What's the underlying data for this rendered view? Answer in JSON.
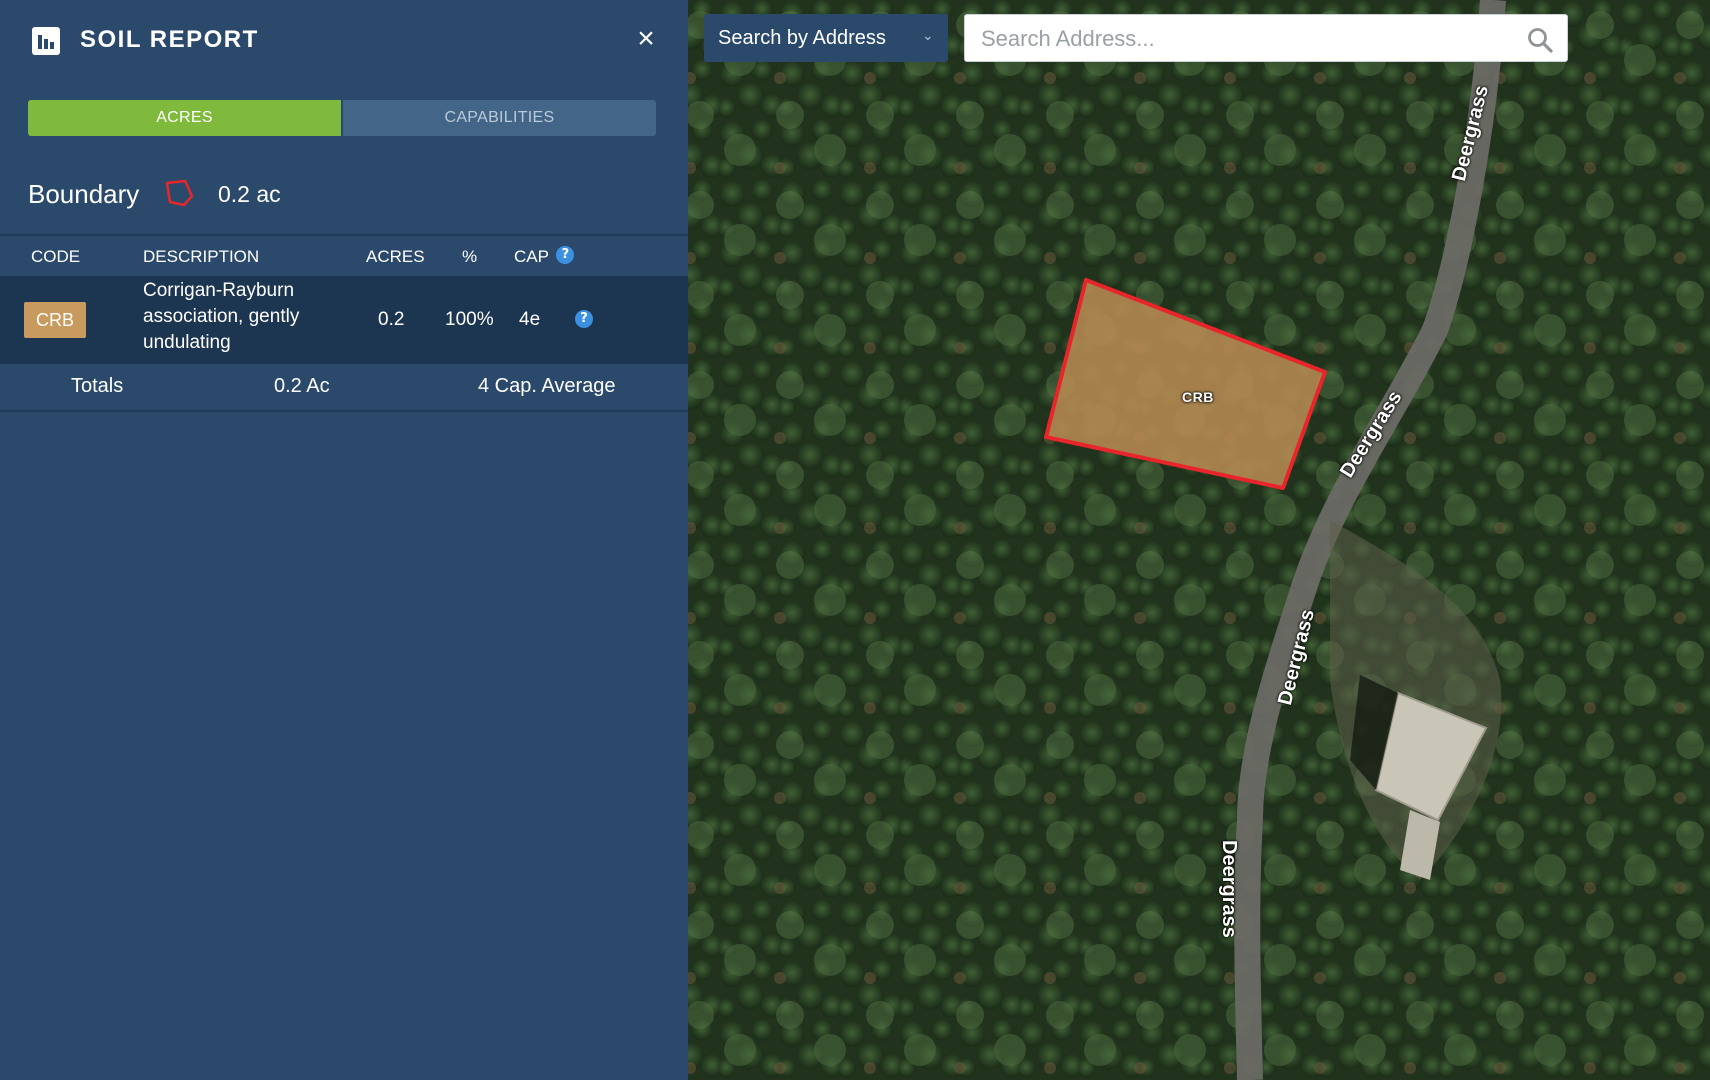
{
  "panel": {
    "title": "SOIL REPORT",
    "close_label": "×",
    "tabs": [
      {
        "label": "ACRES",
        "active": true
      },
      {
        "label": "CAPABILITIES",
        "active": false
      }
    ],
    "boundary": {
      "label": "Boundary",
      "acres": "0.2 ac"
    },
    "table": {
      "headers": {
        "code": "CODE",
        "description": "DESCRIPTION",
        "acres": "ACRES",
        "percent": "%",
        "cap": "CAP"
      },
      "rows": [
        {
          "code": "CRB",
          "description": "Corrigan-Rayburn association, gently undulating",
          "acres": "0.2",
          "percent": "100%",
          "cap": "4e"
        }
      ],
      "totals": {
        "label": "Totals",
        "acres": "0.2 Ac",
        "cap_average": "4 Cap. Average"
      }
    }
  },
  "map": {
    "search_mode": "Search by Address",
    "search_placeholder": "Search Address...",
    "parcel_label": "CRB",
    "road_labels": [
      "Deergrass",
      "Deergrass",
      "Deergrass",
      "Deergrass"
    ],
    "colors": {
      "parcel_fill": "#b68a52",
      "parcel_outline": "#e8252b",
      "road": "#6b6b66"
    }
  },
  "colors": {
    "panel_bg": "#2b4a6b",
    "accent_green": "#7fba3d",
    "soil_badge": "#c99a5e",
    "help_blue": "#3d8fe0"
  }
}
